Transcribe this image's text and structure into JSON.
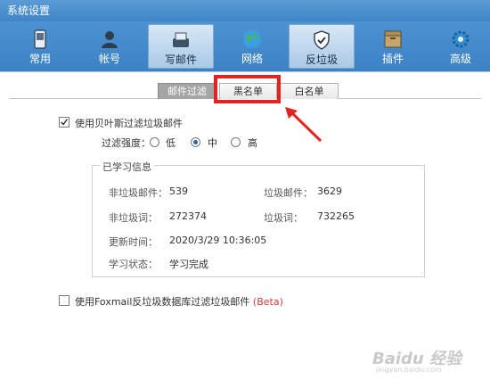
{
  "window": {
    "title": "系统设置"
  },
  "toolbar": {
    "items": [
      {
        "label": "常用",
        "icon": "phone-icon"
      },
      {
        "label": "帐号",
        "icon": "user-icon"
      },
      {
        "label": "写邮件",
        "icon": "compose-icon"
      },
      {
        "label": "网络",
        "icon": "globe-icon"
      },
      {
        "label": "反垃圾",
        "icon": "shield-icon"
      },
      {
        "label": "插件",
        "icon": "plugin-icon"
      },
      {
        "label": "高级",
        "icon": "gear-icon"
      }
    ],
    "active_item": "反垃圾"
  },
  "tabs": {
    "items": [
      "邮件过滤",
      "黑名单",
      "白名单"
    ],
    "selected": "邮件过滤",
    "highlighted": "黑名单"
  },
  "bayes": {
    "checkbox_label": "使用贝叶斯过滤垃圾邮件",
    "checked": true,
    "strength_label": "过滤强度：",
    "options": [
      "低",
      "中",
      "高"
    ],
    "selected_option": "中"
  },
  "learned": {
    "title": "已学习信息",
    "nonspam_mail_label": "非垃圾邮件：",
    "nonspam_mail_value": "539",
    "spam_mail_label": "垃圾邮件：",
    "spam_mail_value": "3629",
    "nonspam_words_label": "非垃圾词：",
    "nonspam_words_value": "272374",
    "spam_words_label": "垃圾词：",
    "spam_words_value": "732265",
    "update_time_label": "更新时间：",
    "update_time_value": "2020/3/29 10:36:05",
    "status_label": "学习状态：",
    "status_value": "学习完成"
  },
  "foxmail_db": {
    "checkbox_label": "使用Foxmail反垃圾数据库过滤垃圾邮件",
    "beta": "(Beta)",
    "checked": false
  },
  "watermark": {
    "text": "Baidu 经验",
    "sub": "jingyan.baidu.com"
  },
  "colors": {
    "toolbar": "#3f86c8",
    "highlight": "#e3231f",
    "beta": "#d03c3c"
  }
}
